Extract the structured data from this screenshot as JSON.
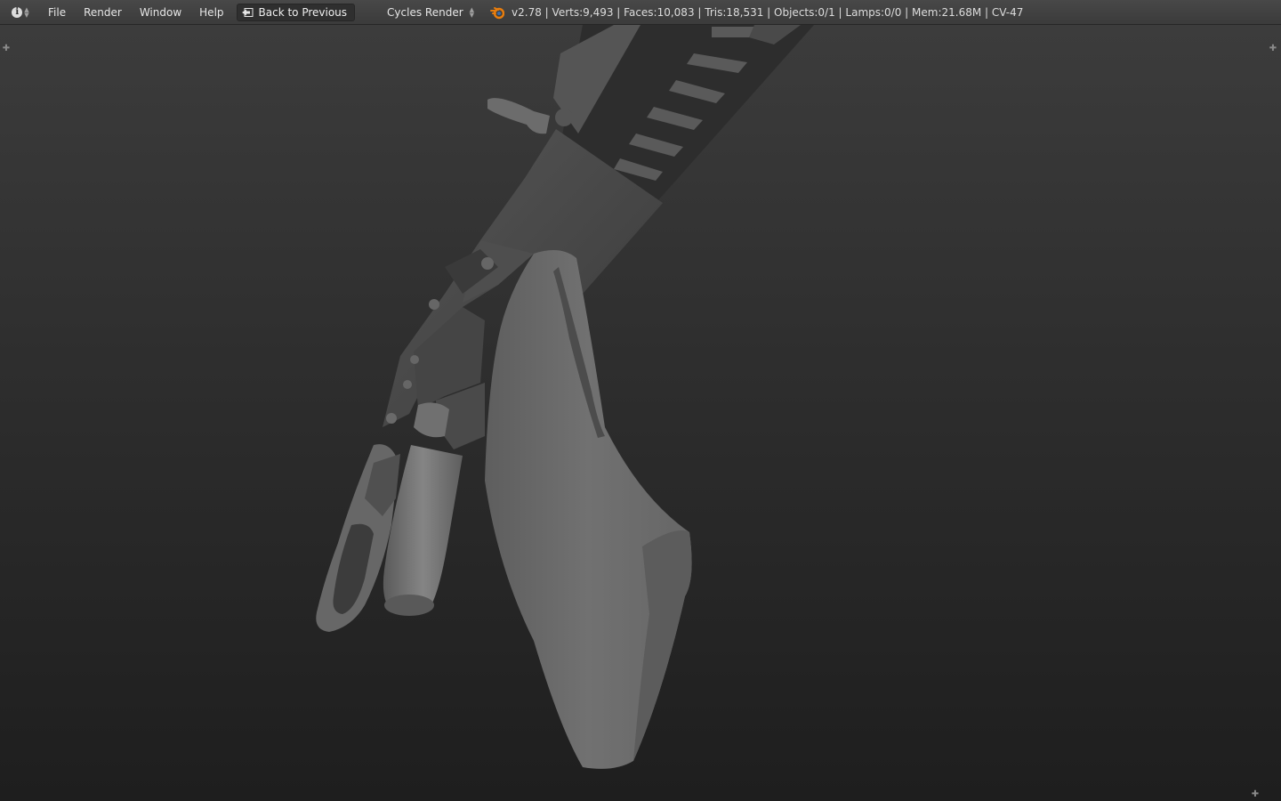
{
  "header": {
    "editor_icon": "info-icon",
    "menus": [
      "File",
      "Render",
      "Window",
      "Help"
    ],
    "back_label": "Back to Previous",
    "render_engine": "Cycles Render",
    "stats": "v2.78 | Verts:9,493 | Faces:10,083 | Tris:18,531 | Objects:0/1 | Lamps:0/0 | Mem:21.68M | CV-47"
  },
  "viewport": {
    "content": "3d-model-rifle-solid-shading",
    "corner_icon": "plus-icon"
  },
  "colors": {
    "header_bg": "#434343",
    "viewport_top": "#3c3c3c",
    "viewport_bottom": "#1e1e1e",
    "model_gray": "#6a6a6a",
    "blender_orange": "#e87d0d"
  }
}
